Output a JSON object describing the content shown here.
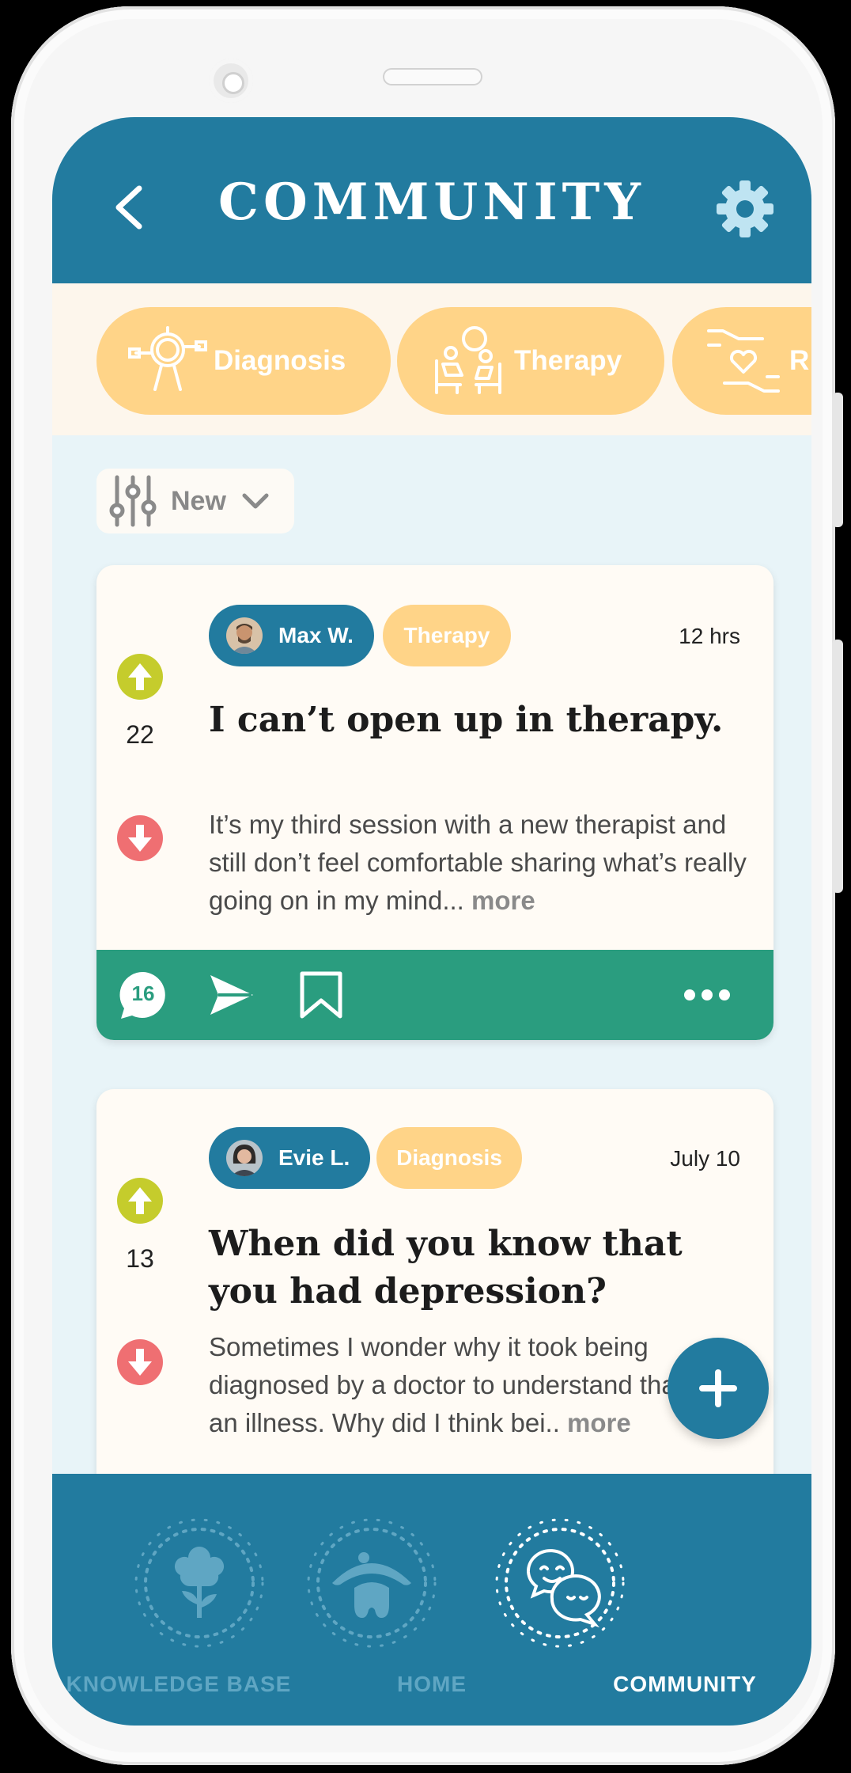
{
  "header": {
    "title": "COMMUNITY"
  },
  "categories": [
    {
      "label": "Diagnosis",
      "icon": "diagnosis-person-icon"
    },
    {
      "label": "Therapy",
      "icon": "therapy-session-icon"
    },
    {
      "label": "R",
      "icon": "hands-heart-icon"
    }
  ],
  "sort": {
    "label": "New",
    "icon": "sliders-icon"
  },
  "posts": [
    {
      "author": "Max W.",
      "tag": "Therapy",
      "time": "12 hrs",
      "votes": "22",
      "title": "I can’t open up in therapy.",
      "body": "It’s my third session with a new therapist and still don’t feel comfortable sharing what’s really going on in my mind...",
      "more": "more",
      "comments": "16"
    },
    {
      "author": "Evie L.",
      "tag": "Diagnosis",
      "time": "July 10",
      "votes": "13",
      "title": "When did you know that you had depression?",
      "body": "Sometimes I wonder why it took being diagnosed by a doctor to understand that I had an illness. Why did I think bei..",
      "more": "more"
    }
  ],
  "nav": [
    {
      "label": "KNOWLEDGE BASE",
      "icon": "brain-plant-icon",
      "active": false
    },
    {
      "label": "HOME",
      "icon": "home-mushroom-icon",
      "active": false
    },
    {
      "label": "COMMUNITY",
      "icon": "chat-faces-icon",
      "active": true
    }
  ],
  "colors": {
    "primary": "#227b9f",
    "chip": "#ffd488",
    "action_bar": "#2a9d7f",
    "upvote": "#c5cc2c",
    "downvote": "#ef6f72",
    "background": "#e8f4f8",
    "card": "#fffbf5"
  }
}
